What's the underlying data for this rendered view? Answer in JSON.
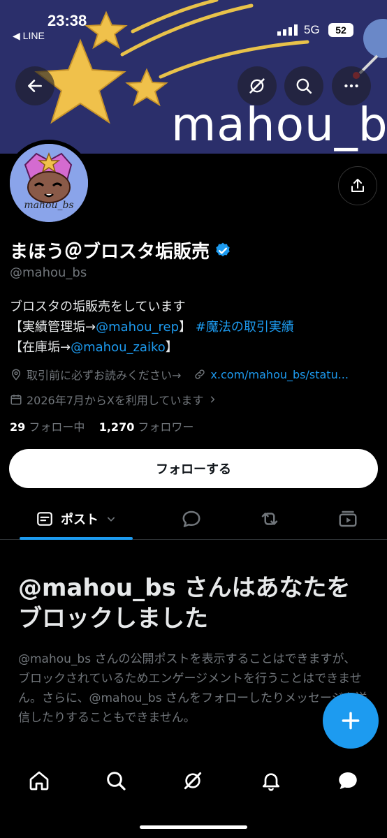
{
  "status_bar": {
    "time": "23:38",
    "back_app": "◀ LINE",
    "network": "5G",
    "battery": "52"
  },
  "banner": {
    "text": "mahou_bs"
  },
  "profile": {
    "display_name": "まほう＠ブロスタ垢販売",
    "handle": "@mahou_bs",
    "bio_line1": "ブロスタの垢販売をしています",
    "bio_line2_prefix": "【実績管理垢→",
    "bio_line2_link": "@mahou_rep",
    "bio_line2_suffix": "】",
    "bio_line2_hashtag": "#魔法の取引実績",
    "bio_line3_prefix": "【在庫垢→",
    "bio_line3_link": "@mahou_zaiko",
    "bio_line3_suffix": "】",
    "location": "取引前に必ずお読みください→",
    "website": "x.com/mahou_bs/statu...",
    "joined": "2026年7月からXを利用しています",
    "following_count": "29",
    "following_label": "フォロー中",
    "followers_count": "1,270",
    "followers_label": "フォロワー",
    "avatar_text": "mahou_bs"
  },
  "follow_button": "フォローする",
  "tabs": {
    "posts": "ポスト"
  },
  "blocked": {
    "title": "@mahou_bs さんはあなたをブロックしました",
    "message": "@mahou_bs さんの公開ポストを表示することはできますが、ブロックされているためエンゲージメントを行うことはできません。さらに、@mahou_bs さんをフォローしたりメッセージを送信したりすることもできません。"
  },
  "colors": {
    "accent": "#1d9bf0",
    "banner_bg": "#2b2f6b",
    "star": "#f0c14b"
  },
  "icons": [
    "back-arrow-icon",
    "grok-icon",
    "search-icon",
    "more-icon",
    "share-icon",
    "verified-badge-icon",
    "location-icon",
    "link-icon",
    "calendar-icon",
    "posts-icon",
    "replies-icon",
    "reposts-icon",
    "media-icon",
    "plus-icon",
    "home-icon",
    "explore-icon",
    "notifications-icon",
    "messages-icon"
  ]
}
